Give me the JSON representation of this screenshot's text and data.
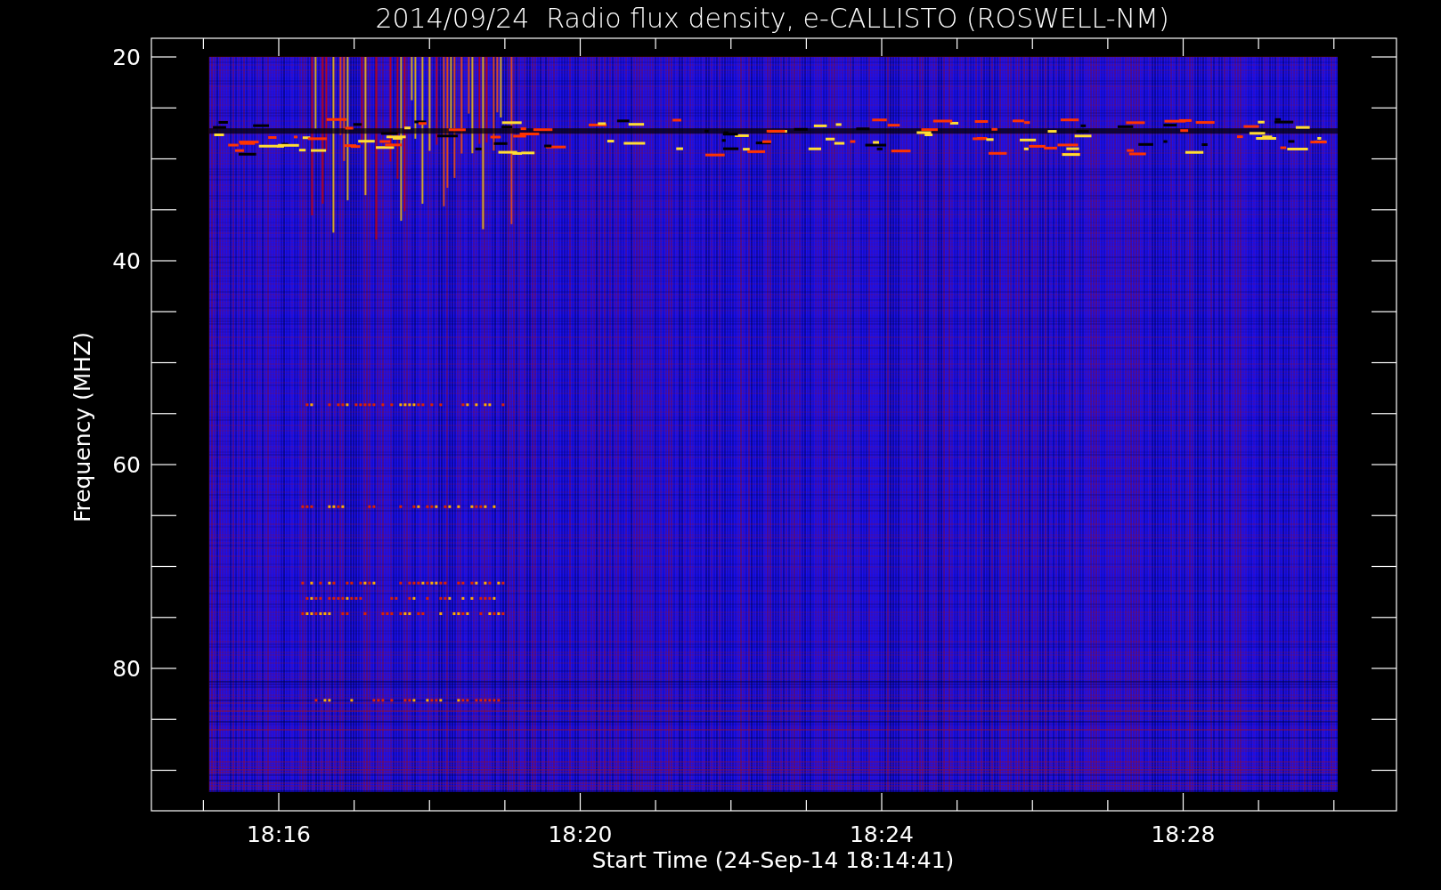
{
  "title": "2014/09/24  Radio flux density, e-CALLISTO (ROSWELL-NM)",
  "y_axis": {
    "label": "Frequency (MHZ)",
    "tick_labels": [
      "20",
      "40",
      "60",
      "80"
    ]
  },
  "x_axis": {
    "label": "Start Time (24-Sep-14 18:14:41)",
    "tick_labels": [
      "18:16",
      "18:20",
      "18:24",
      "18:28"
    ]
  }
}
